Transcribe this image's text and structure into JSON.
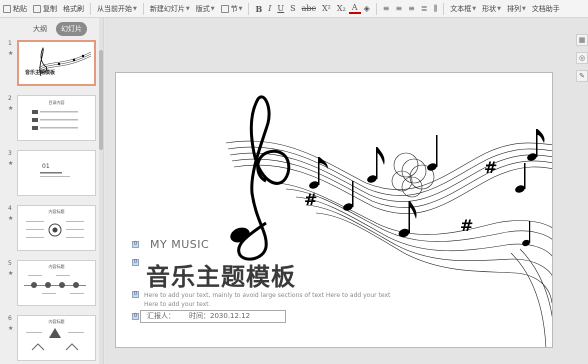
{
  "toolbar": {
    "items": [
      "粘贴",
      "复制",
      "格式刷",
      "从当前开始",
      "新建幻灯片",
      "版式",
      "节",
      "文本框",
      "形状",
      "排列",
      "文档助手"
    ]
  },
  "panel": {
    "tab_outline": "大纲",
    "tab_slides": "幻灯片"
  },
  "thumbs": [
    {
      "num": "1",
      "title": "音乐主题模板"
    },
    {
      "num": "2",
      "title": "目录内容"
    },
    {
      "num": "3",
      "title": "01"
    },
    {
      "num": "4",
      "title": "内容标题"
    },
    {
      "num": "5",
      "title": "内容标题"
    },
    {
      "num": "6",
      "title": "内容标题"
    }
  ],
  "slide": {
    "subtitle": "MY MUSIC",
    "title": "音乐主题模板",
    "desc": "Here to add your text, mainly to avoid large sections of text Here to add your text Here to add your text.",
    "reporter_label": "汇报人：",
    "time_label": "时间：2030.12.12",
    "placeholder_badge": "0"
  }
}
